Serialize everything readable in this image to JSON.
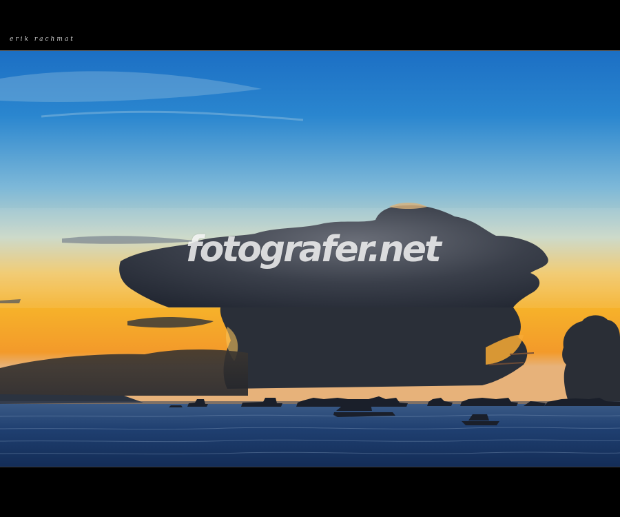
{
  "signature": "erik rachmat",
  "watermark": "fotografer.net",
  "colors": {
    "frame": "#000000",
    "sky_top": "#1f74c6",
    "sky_mid": "#7fb6d6",
    "horizon_glow": "#f6b42a",
    "cloud_dark": "#2a2f3a",
    "sea": "#1b3a6a"
  }
}
